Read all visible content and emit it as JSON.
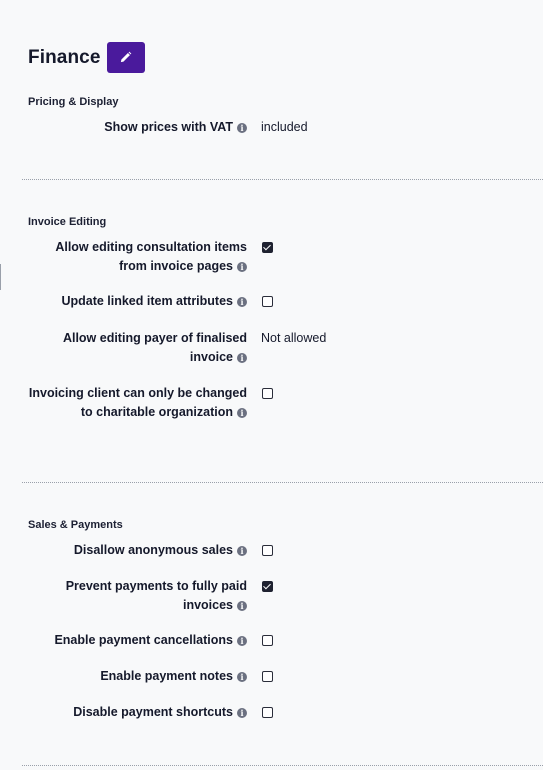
{
  "header": {
    "title": "Finance",
    "edit_icon": "pencil-icon"
  },
  "info_icon_glyph": "i",
  "sections": {
    "pricing": {
      "title": "Pricing & Display",
      "rows": [
        {
          "label": "Show prices with VAT",
          "type": "text",
          "value": "included"
        }
      ]
    },
    "invoice": {
      "title": "Invoice Editing",
      "rows": [
        {
          "label": "Allow editing consultation items from invoice pages",
          "type": "checkbox",
          "checked": true
        },
        {
          "label": "Update linked item attributes",
          "type": "checkbox",
          "checked": false
        },
        {
          "label": "Allow editing payer of finalised invoice",
          "type": "text",
          "value": "Not allowed"
        },
        {
          "label": "Invoicing client can only be changed to charitable organization",
          "type": "checkbox",
          "checked": false
        }
      ]
    },
    "sales": {
      "title": "Sales & Payments",
      "rows": [
        {
          "label": "Disallow anonymous sales",
          "type": "checkbox",
          "checked": false
        },
        {
          "label": "Prevent payments to fully paid invoices",
          "type": "checkbox",
          "checked": true
        },
        {
          "label": "Enable payment cancellations",
          "type": "checkbox",
          "checked": false
        },
        {
          "label": "Enable payment notes",
          "type": "checkbox",
          "checked": false
        },
        {
          "label": "Disable payment shortcuts",
          "type": "checkbox",
          "checked": false
        }
      ]
    }
  }
}
